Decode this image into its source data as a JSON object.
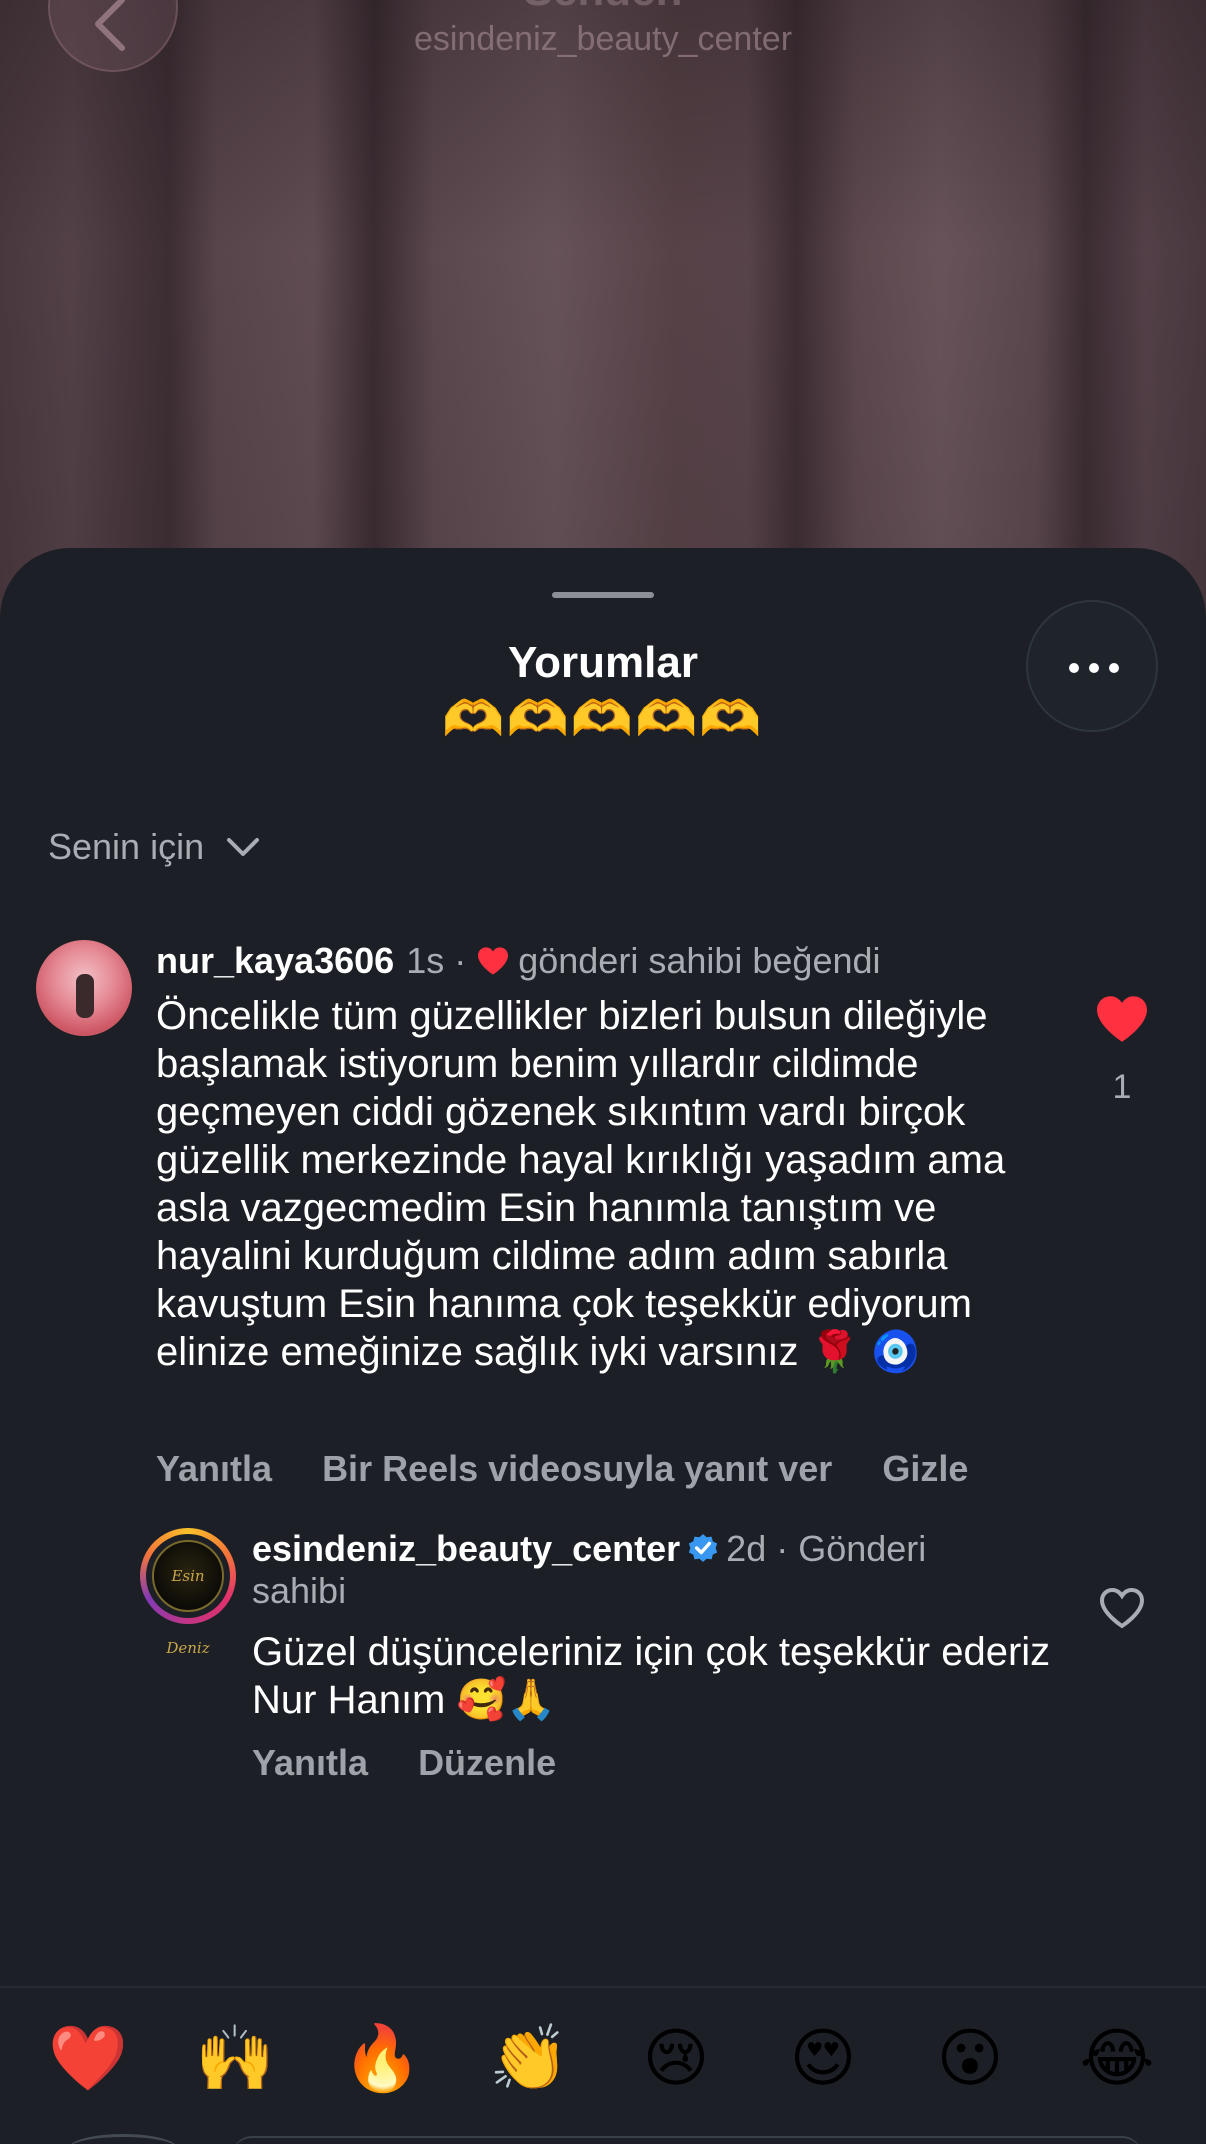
{
  "video": {
    "title": "Senden",
    "subtitle": "esindeniz_beauty_center"
  },
  "sheet": {
    "title": "Yorumlar",
    "emojis": "🫶🫶🫶🫶🫶",
    "sort_label": "Senin için"
  },
  "comments": [
    {
      "username": "nur_kaya3606",
      "time": "1s",
      "separator": "·",
      "liked_by_author": "gönderi sahibi beğendi",
      "text": "Öncelikle tüm güzellikler bizleri bulsun dileğiyle başlamak istiyorum benim yıllardır cildimde geçmeyen ciddi gözenek sıkıntım vardı birçok güzellik merkezinde hayal kırıklığı yaşadım ama asla vazgecmedim Esin hanımla tanıştım ve hayalini kurduğum cildime adım adım sabırla kavuştum Esin hanıma çok teşekkür ediyorum elinize emeğinize sağlık iyki varsınız 🌹 🧿",
      "actions": [
        "Yanıtla",
        "Bir Reels videosuyla yanıt ver",
        "Gizle"
      ],
      "like_count": "1",
      "liked": true
    }
  ],
  "reply": {
    "username": "esindeniz_beauty_center",
    "time_meta": "2d · Gönderi sahibi",
    "avatar_text": "Esin Deniz",
    "text": "Güzel düşünceleriniz için çok teşekkür ederiz Nur Hanım 🥰🙏",
    "actions": [
      "Yanıtla",
      "Düzenle"
    ],
    "liked": false
  },
  "reactions": [
    "❤️",
    "🙌",
    "🔥",
    "👏",
    "😢",
    "😍",
    "😮",
    "😂"
  ],
  "colors": {
    "sheet_bg": "#1c2026",
    "text_primary": "#ffffff",
    "text_secondary": "#a9adb3",
    "like_red": "#ff3040",
    "verified_blue": "#3897f0"
  }
}
